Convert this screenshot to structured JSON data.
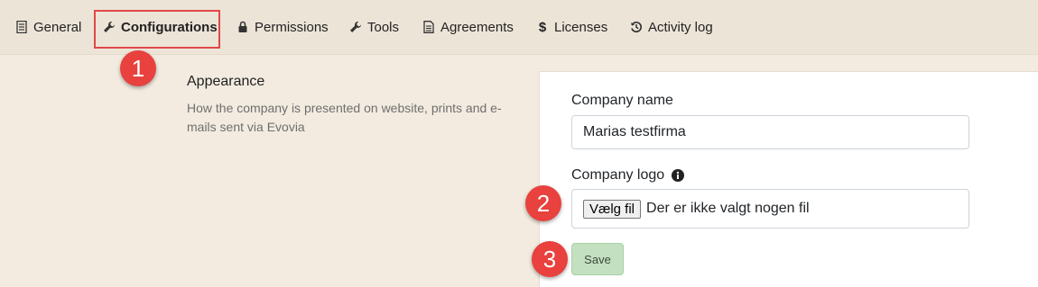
{
  "tabs": [
    {
      "label": "General",
      "icon": "document-icon"
    },
    {
      "label": "Configurations",
      "icon": "wrench-icon",
      "active": true
    },
    {
      "label": "Permissions",
      "icon": "lock-icon"
    },
    {
      "label": "Tools",
      "icon": "wrench-icon"
    },
    {
      "label": "Agreements",
      "icon": "file-text-icon"
    },
    {
      "label": "Licenses",
      "icon": "dollar-icon"
    },
    {
      "label": "Activity log",
      "icon": "history-icon"
    }
  ],
  "section": {
    "title": "Appearance",
    "description": "How the company is presented on website, prints and e-mails sent via Evovia"
  },
  "form": {
    "company_name_label": "Company name",
    "company_name_value": "Marias testfirma",
    "company_logo_label": "Company logo",
    "file_button_label": "Vælg fil",
    "file_status": "Der er ikke valgt nogen fil",
    "save_label": "Save"
  },
  "markers": [
    "1",
    "2",
    "3"
  ],
  "colors": {
    "page_bg": "#f3ebe0",
    "tabbar_bg": "#ede4d8",
    "highlight": "#e04848",
    "marker": "#e8413e",
    "save_bg": "#c3e1c0"
  }
}
